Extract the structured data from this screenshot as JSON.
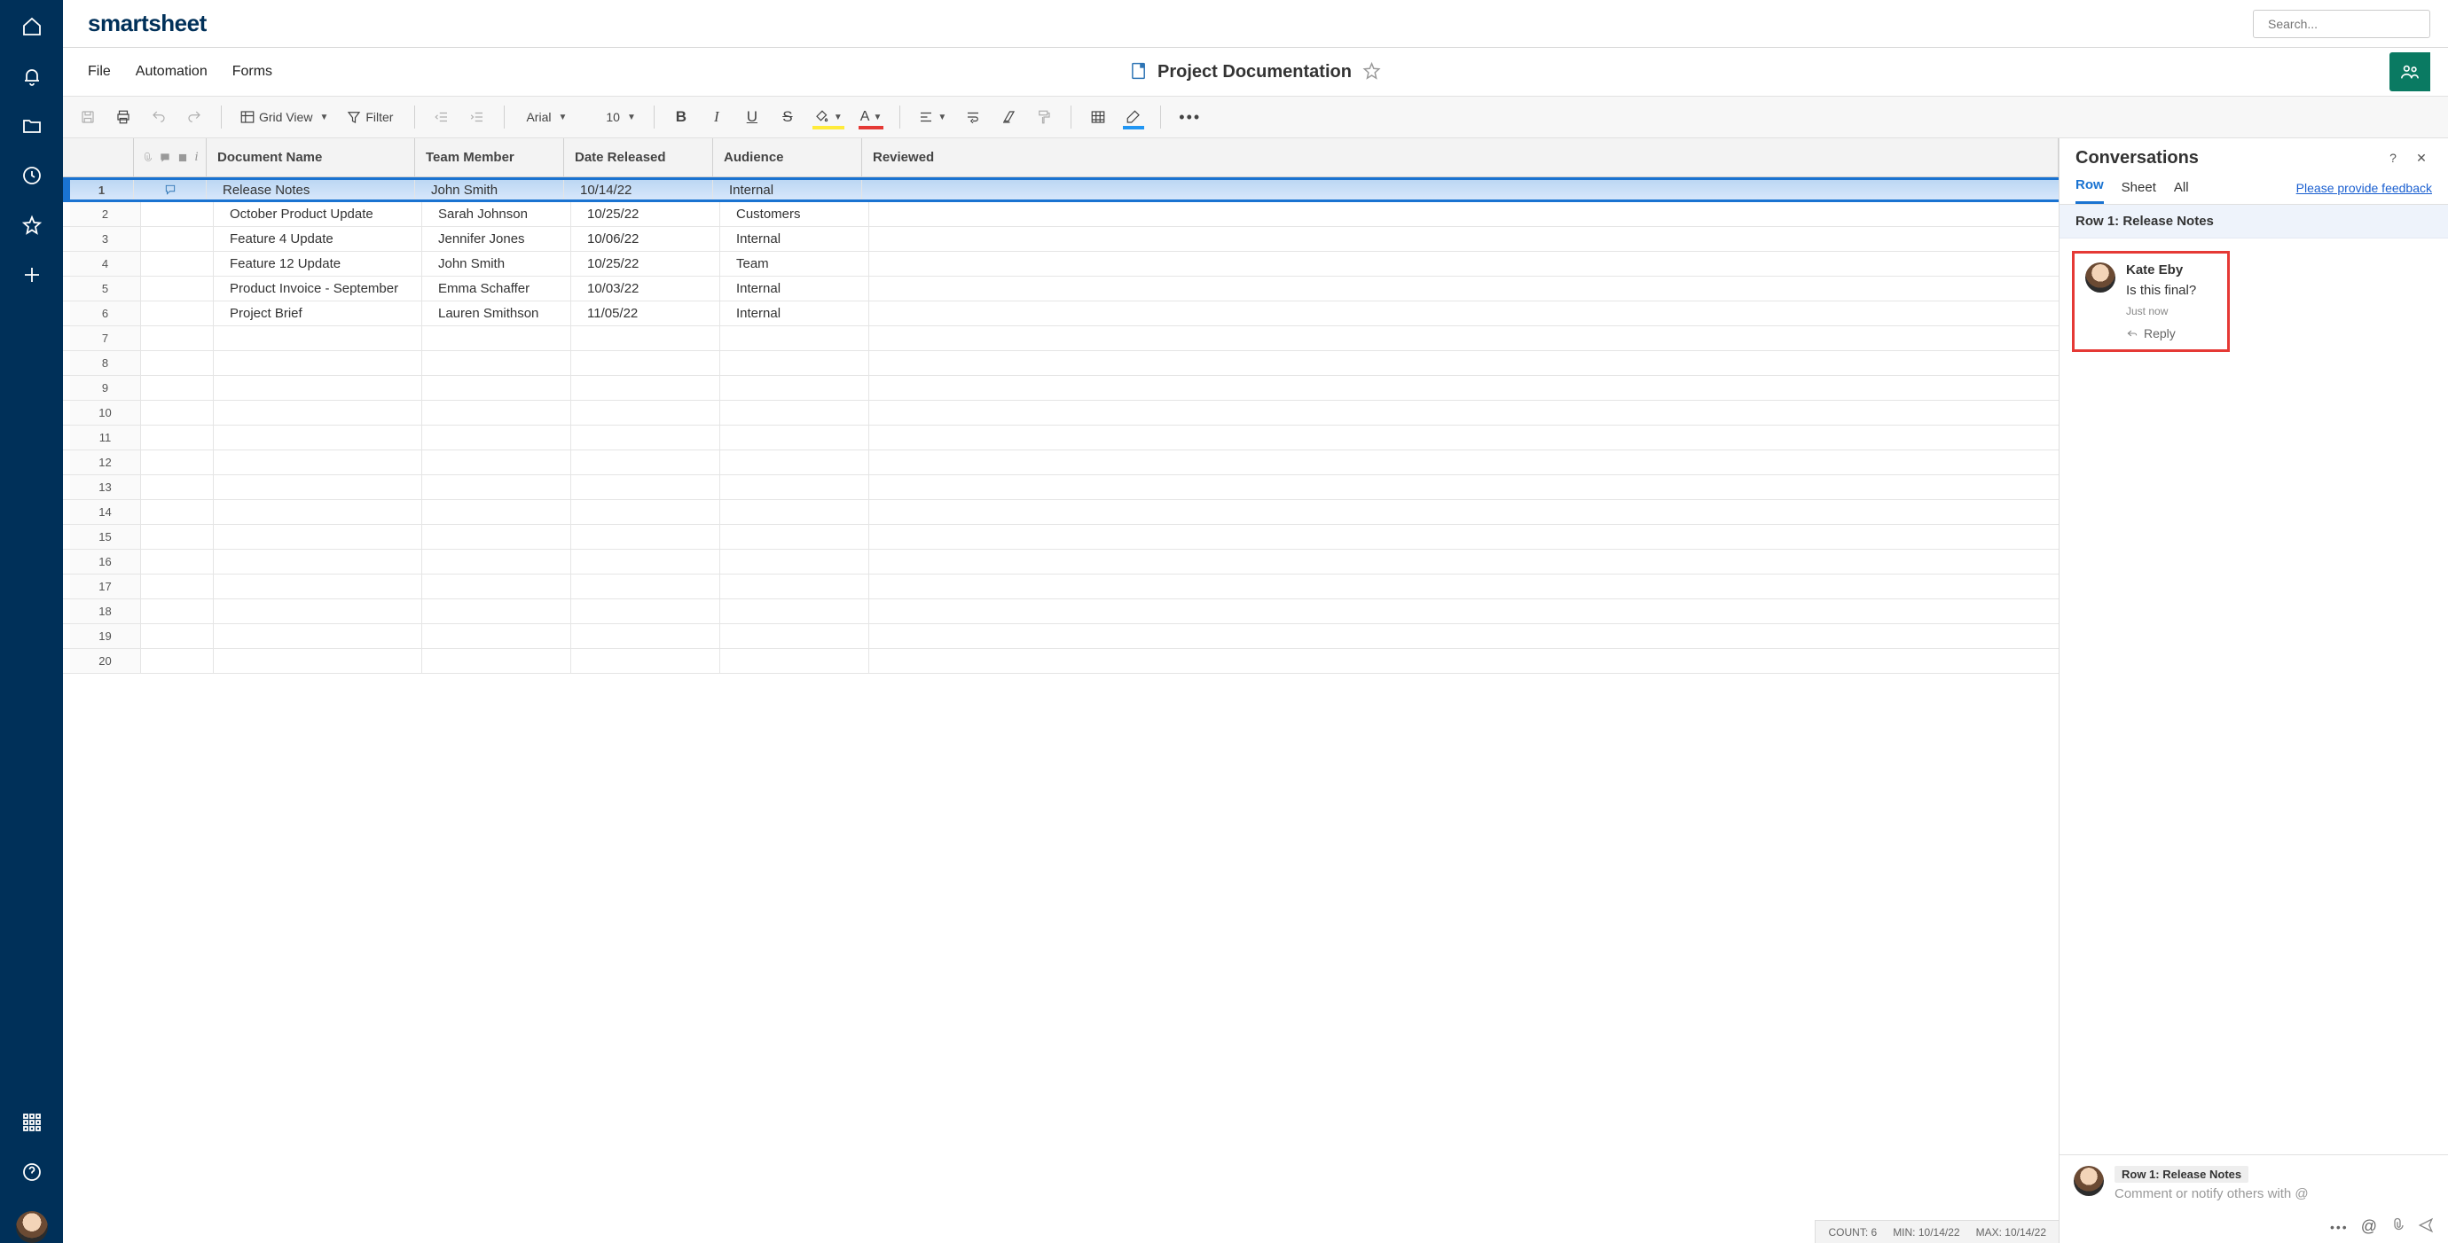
{
  "brand": "smartsheet",
  "search_placeholder": "Search...",
  "menubar": {
    "file": "File",
    "automation": "Automation",
    "forms": "Forms"
  },
  "document": {
    "title": "Project Documentation"
  },
  "toolbar": {
    "grid_view": "Grid View",
    "filter": "Filter",
    "font": "Arial",
    "font_size": "10"
  },
  "columns": {
    "doc": "Document Name",
    "mem": "Team Member",
    "date": "Date Released",
    "aud": "Audience",
    "rev": "Reviewed"
  },
  "rows": [
    {
      "n": "1",
      "doc": "Release Notes",
      "mem": "John Smith",
      "date": "10/14/22",
      "aud": "Internal",
      "selected": true,
      "has_comment": true
    },
    {
      "n": "2",
      "doc": "October Product Update",
      "mem": "Sarah Johnson",
      "date": "10/25/22",
      "aud": "Customers"
    },
    {
      "n": "3",
      "doc": "Feature 4 Update",
      "mem": "Jennifer Jones",
      "date": "10/06/22",
      "aud": "Internal"
    },
    {
      "n": "4",
      "doc": "Feature 12 Update",
      "mem": "John Smith",
      "date": "10/25/22",
      "aud": "Team"
    },
    {
      "n": "5",
      "doc": "Product Invoice - September",
      "mem": "Emma Schaffer",
      "date": "10/03/22",
      "aud": "Internal"
    },
    {
      "n": "6",
      "doc": "Project Brief",
      "mem": "Lauren Smithson",
      "date": "11/05/22",
      "aud": "Internal"
    },
    {
      "n": "7"
    },
    {
      "n": "8"
    },
    {
      "n": "9"
    },
    {
      "n": "10"
    },
    {
      "n": "11"
    },
    {
      "n": "12"
    },
    {
      "n": "13"
    },
    {
      "n": "14"
    },
    {
      "n": "15"
    },
    {
      "n": "16"
    },
    {
      "n": "17"
    },
    {
      "n": "18"
    },
    {
      "n": "19"
    },
    {
      "n": "20"
    }
  ],
  "status": {
    "count_label": "COUNT:",
    "count_val": "6",
    "min_label": "MIN:",
    "min_val": "10/14/22",
    "max_label": "MAX:",
    "max_val": "10/14/22"
  },
  "conversations": {
    "title": "Conversations",
    "tabs": {
      "row": "Row",
      "sheet": "Sheet",
      "all": "All"
    },
    "feedback": "Please provide feedback",
    "row_label": "Row 1: Release Notes",
    "comment": {
      "author": "Kate Eby",
      "text": "Is this final?",
      "time": "Just now",
      "reply": "Reply"
    },
    "compose": {
      "tag": "Row 1: Release Notes",
      "placeholder": "Comment or notify others with @"
    }
  }
}
